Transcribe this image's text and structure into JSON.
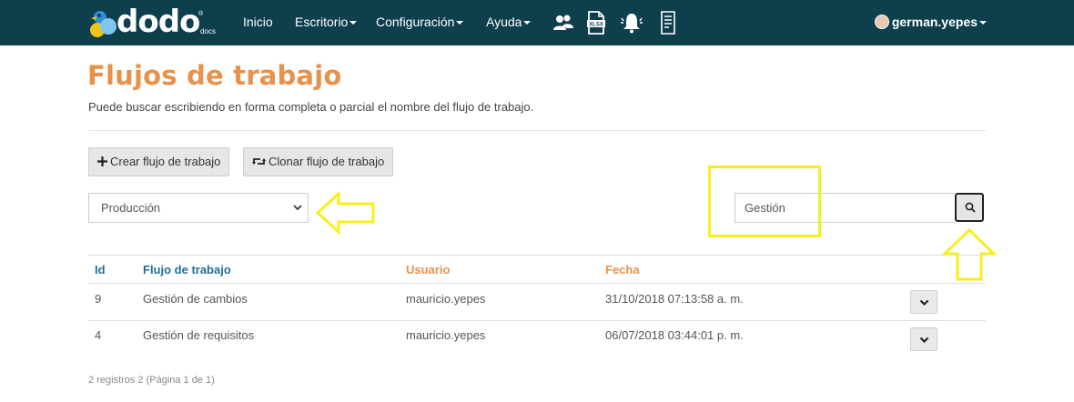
{
  "brand": {
    "name": "dodo",
    "sub": "docs",
    "reg": "®"
  },
  "nav": {
    "items": [
      {
        "label": "Inicio",
        "dropdown": false
      },
      {
        "label": "Escritorio",
        "dropdown": true
      },
      {
        "label": "Configuración",
        "dropdown": true
      },
      {
        "label": "Ayuda",
        "dropdown": true
      }
    ],
    "icons": [
      "users-icon",
      "xlsx-file-icon",
      "bell-icon",
      "document-list-icon"
    ],
    "user": "german.yepes"
  },
  "page": {
    "title": "Flujos de trabajo",
    "description": "Puede buscar escribiendo en forma completa o parcial el nombre del flujo de trabajo."
  },
  "actions": {
    "create_label": "Crear flujo de trabajo",
    "clone_label": "Clonar flujo de trabajo"
  },
  "filter": {
    "selected": "Producción"
  },
  "search": {
    "value": "Gestión"
  },
  "table": {
    "headers": {
      "id": "Id",
      "name": "Flujo de trabajo",
      "user": "Usuario",
      "date": "Fecha"
    },
    "rows": [
      {
        "id": "9",
        "name": "Gestión de cambios",
        "user": "mauricio.yepes",
        "date": "31/10/2018 07:13:58 a. m."
      },
      {
        "id": "4",
        "name": "Gestión de requisitos",
        "user": "mauricio.yepes",
        "date": "06/07/2018 03:44:01 p. m."
      }
    ]
  },
  "footer": {
    "summary": "2 registros 2 (Página 1 de 1)"
  },
  "colors": {
    "navbar": "#0e3f4c",
    "title": "#e8914a",
    "header_blue": "#1f6f95",
    "annotation": "#f6f01a"
  }
}
